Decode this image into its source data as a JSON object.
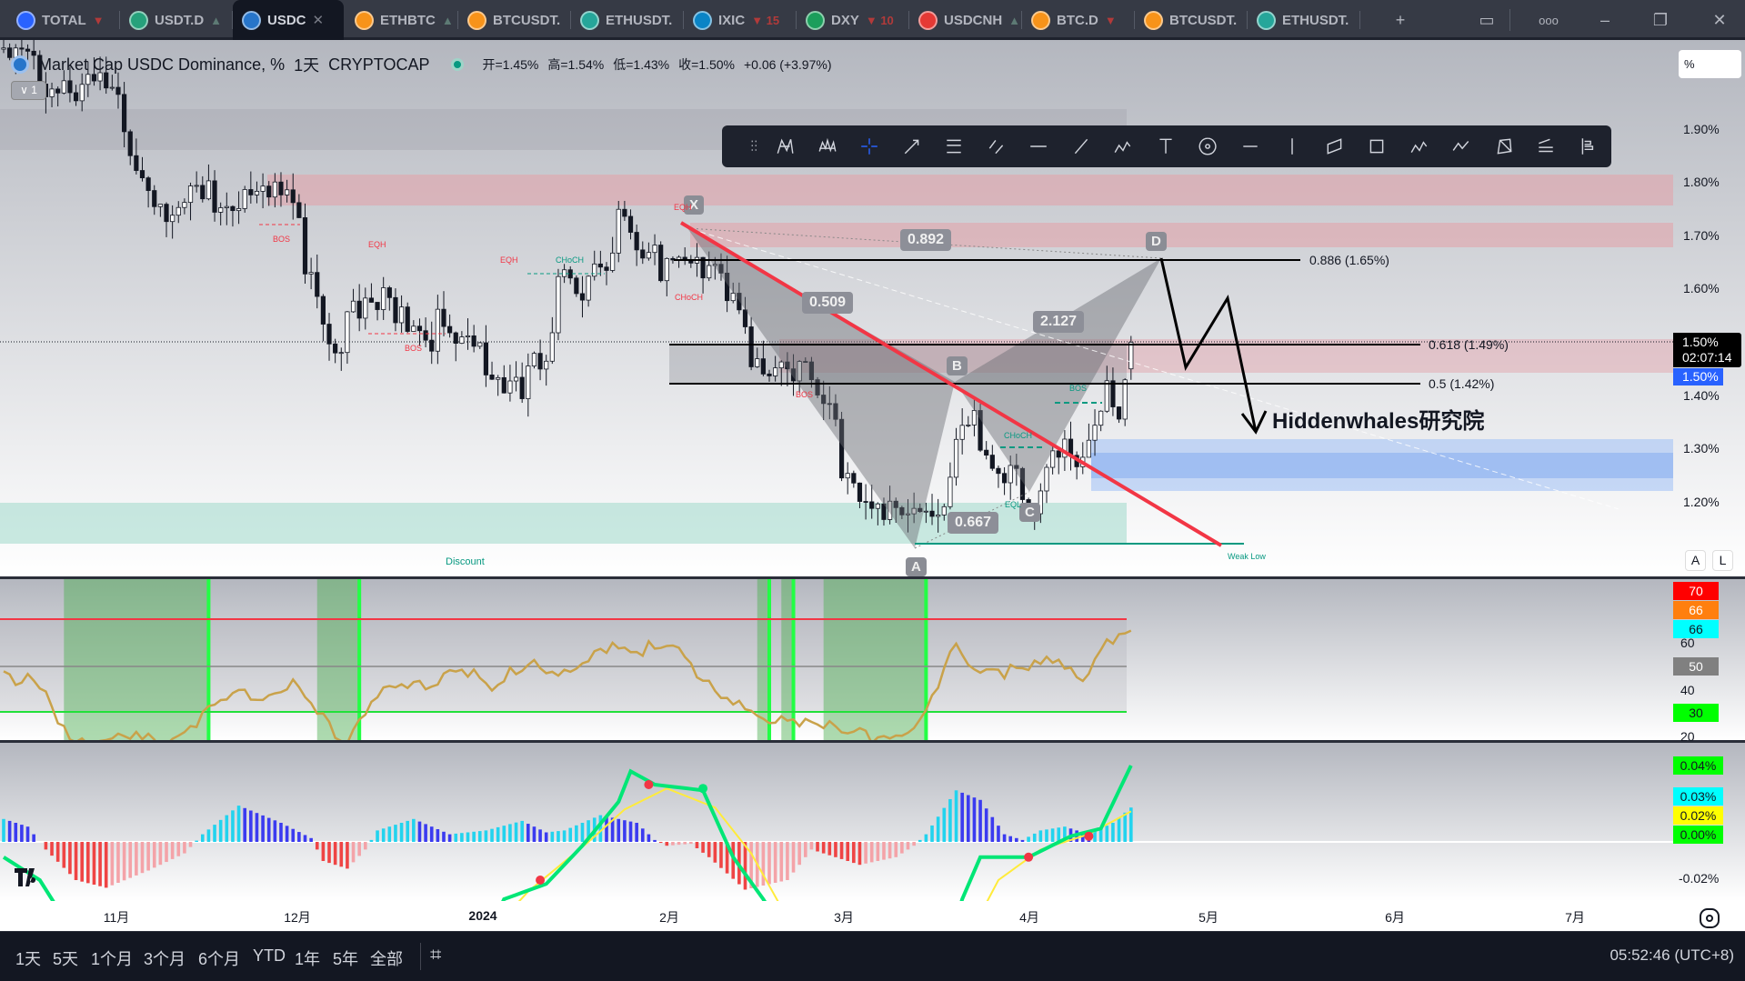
{
  "tabs": [
    {
      "label": "TOTAL",
      "change": "▼",
      "icon_color": "#2962ff"
    },
    {
      "label": "USDT.D",
      "change": "▲",
      "icon_color": "#26a17b"
    },
    {
      "label": "USDC",
      "change": "",
      "icon_color": "#2775ca",
      "active": true
    },
    {
      "label": "ETHBTC",
      "change": "▲",
      "icon_color": "#f7931a"
    },
    {
      "label": "BTCUSDT.",
      "change": "",
      "icon_color": "#f7931a"
    },
    {
      "label": "ETHUSDT.",
      "change": "",
      "icon_color": "#26a69a"
    },
    {
      "label": "IXIC",
      "change": "▼ 15",
      "icon_color": "#0a84c6"
    },
    {
      "label": "DXY",
      "change": "▼ 10",
      "icon_color": "#1b9e5b"
    },
    {
      "label": "USDCNH",
      "change": "▲",
      "icon_color": "#e53935"
    },
    {
      "label": "BTC.D",
      "change": "▼",
      "icon_color": "#f7931a"
    },
    {
      "label": "BTCUSDT.",
      "change": "",
      "icon_color": "#f7931a"
    },
    {
      "label": "ETHUSDT.",
      "change": "",
      "icon_color": "#26a69a"
    }
  ],
  "window": {
    "add_tab": "+",
    "layout": "▭",
    "more": "ooo",
    "minimize": "–",
    "restore": "❐",
    "close": "✕",
    "close_tab": "✕"
  },
  "legend": {
    "title": "Market Cap USDC Dominance, %",
    "interval": "1天",
    "exchange": "CRYPTOCAP",
    "open": "开=1.45%",
    "high": "高=1.54%",
    "low": "低=1.43%",
    "close": "收=1.50%",
    "change": "+0.06 (+3.97%)",
    "collapse": "∨ 1",
    "scale_mode": "%"
  },
  "toolbar_icons": [
    "drag-handle-icon",
    "xabcd-pattern-icon",
    "elliott-wave-icon",
    "crosshair-icon",
    "arrow-icon",
    "fib-retracement-icon",
    "parallel-channel-icon",
    "horizontal-ray-icon",
    "trend-line-icon",
    "abcd-numbered-icon",
    "text-icon",
    "circle-icon",
    "horizontal-line-icon",
    "vertical-line-icon",
    "parallelogram-icon",
    "rectangle-icon",
    "abc-pattern-icon",
    "path-icon",
    "triangle-pattern-icon",
    "fib-fan-icon",
    "long-position-icon"
  ],
  "price_axis": {
    "labels": [
      "1.90%",
      "1.80%",
      "1.70%",
      "1.60%",
      "1.40%",
      "1.30%",
      "1.20%"
    ],
    "last_price": "1.50%",
    "countdown": "02:07:14",
    "bid": "1.50%",
    "auto": "A",
    "log": "L"
  },
  "rsi_axis": {
    "labels": [
      "60",
      "40",
      "20"
    ],
    "tags": [
      {
        "text": "70",
        "color": "#ff0000"
      },
      {
        "text": "66",
        "color": "#ff7f0e"
      },
      {
        "text": "66",
        "color": "#00ffff"
      },
      {
        "text": "50",
        "color": "#808080"
      },
      {
        "text": "30",
        "color": "#00ff00"
      }
    ]
  },
  "macd_axis": {
    "labels": [
      "-0.02%"
    ],
    "tags": [
      {
        "text": "0.04%",
        "color": "#00ff00"
      },
      {
        "text": "0.03%",
        "color": "#00ffff"
      },
      {
        "text": "0.02%",
        "color": "#ffff00"
      },
      {
        "text": "0.00%",
        "color": "#00ff00"
      }
    ]
  },
  "time_axis": [
    "11月",
    "12月",
    "2024",
    "2月",
    "3月",
    "4月",
    "5月",
    "6月",
    "7月"
  ],
  "harmonic": {
    "points": [
      "X",
      "A",
      "B",
      "C",
      "D"
    ],
    "ratios": [
      "0.892",
      "0.509",
      "2.127",
      "0.667"
    ]
  },
  "fib_levels": [
    "0.886 (1.65%)",
    "0.618 (1.49%)",
    "0.5 (1.42%)"
  ],
  "smc_labels": [
    "BOS",
    "EQH",
    "BOS",
    "EQH",
    "CHoCH",
    "EQH",
    "CHoCH",
    "BOS",
    "BOS",
    "CHoCH",
    "EQL",
    "Discount",
    "Weak Low"
  ],
  "watermark_text": "Hiddenwhales研究院",
  "bottom": {
    "ranges": [
      "1天",
      "5天",
      "1个月",
      "3个月",
      "6个月",
      "YTD",
      "1年",
      "5年",
      "全部"
    ],
    "clock": "05:52:46 (UTC+8)"
  },
  "colors": {
    "up": "#ffffff",
    "down": "#131722",
    "rsi": "#c9a24a",
    "trend": "#f23645",
    "macd": "#00e676",
    "signal": "#ffeb3b"
  },
  "series": {
    "price_anchors": [
      [
        0,
        2.05
      ],
      [
        18,
        1.99
      ],
      [
        28,
        1.75
      ],
      [
        40,
        1.83
      ],
      [
        48,
        1.76
      ],
      [
        55,
        1.54
      ],
      [
        66,
        1.6
      ],
      [
        81,
        1.47
      ],
      [
        90,
        1.45
      ],
      [
        92,
        1.6
      ],
      [
        102,
        1.73
      ],
      [
        106,
        1.66
      ],
      [
        114,
        1.71
      ],
      [
        124,
        1.52
      ],
      [
        133,
        1.47
      ],
      [
        140,
        1.29
      ],
      [
        148,
        1.19
      ],
      [
        152,
        1.16
      ],
      [
        156,
        1.26
      ],
      [
        159,
        1.41
      ],
      [
        164,
        1.26
      ],
      [
        171,
        1.23
      ],
      [
        174,
        1.34
      ],
      [
        179,
        1.26
      ],
      [
        183,
        1.41
      ],
      [
        185,
        1.43
      ],
      [
        187,
        1.5
      ]
    ],
    "rsi_anchors": [
      [
        0,
        50
      ],
      [
        6,
        42
      ],
      [
        10,
        22
      ],
      [
        17,
        20
      ],
      [
        26,
        19
      ],
      [
        34,
        32
      ],
      [
        40,
        39
      ],
      [
        48,
        44
      ],
      [
        52,
        30
      ],
      [
        57,
        21
      ],
      [
        61,
        39
      ],
      [
        68,
        41
      ],
      [
        76,
        54
      ],
      [
        81,
        39
      ],
      [
        87,
        56
      ],
      [
        94,
        46
      ],
      [
        101,
        63
      ],
      [
        105,
        60
      ],
      [
        111,
        58
      ],
      [
        118,
        44
      ],
      [
        126,
        26
      ],
      [
        133,
        30
      ],
      [
        140,
        21
      ],
      [
        148,
        23
      ],
      [
        153,
        30
      ],
      [
        158,
        60
      ],
      [
        162,
        51
      ],
      [
        170,
        49
      ],
      [
        174,
        56
      ],
      [
        179,
        49
      ],
      [
        182,
        58
      ],
      [
        187,
        66
      ]
    ],
    "rsi_oversold_ranges": [
      [
        10,
        34
      ],
      [
        52,
        59
      ],
      [
        125,
        127
      ],
      [
        129,
        131
      ],
      [
        136,
        153
      ]
    ],
    "hist_anchors": [
      [
        0,
        0.012
      ],
      [
        4,
        0.008
      ],
      [
        7,
        -0.004
      ],
      [
        12,
        -0.02
      ],
      [
        17,
        -0.024
      ],
      [
        24,
        -0.015
      ],
      [
        30,
        -0.006
      ],
      [
        33,
        0.004
      ],
      [
        39,
        0.019
      ],
      [
        46,
        0.01
      ],
      [
        51,
        0.002
      ],
      [
        53,
        -0.01
      ],
      [
        57,
        -0.014
      ],
      [
        60,
        -0.004
      ],
      [
        62,
        0.006
      ],
      [
        68,
        0.012
      ],
      [
        74,
        0.004
      ],
      [
        80,
        0.006
      ],
      [
        86,
        0.011
      ],
      [
        90,
        0.005
      ],
      [
        93,
        0.006
      ],
      [
        99,
        0.014
      ],
      [
        105,
        0.01
      ],
      [
        108,
        0.001
      ],
      [
        110,
        -0.002
      ],
      [
        114,
        -0.001
      ],
      [
        117,
        -0.008
      ],
      [
        123,
        -0.025
      ],
      [
        130,
        -0.02
      ],
      [
        134,
        -0.004
      ],
      [
        136,
        -0.006
      ],
      [
        142,
        -0.012
      ],
      [
        148,
        -0.008
      ],
      [
        151,
        -0.002
      ],
      [
        153,
        0.004
      ],
      [
        158,
        0.027
      ],
      [
        162,
        0.022
      ],
      [
        166,
        0.004
      ],
      [
        169,
        0.001
      ],
      [
        172,
        0.006
      ],
      [
        176,
        0.008
      ],
      [
        180,
        0.004
      ],
      [
        184,
        0.01
      ],
      [
        187,
        0.018
      ]
    ],
    "macd_anchors": [
      [
        0,
        -0.008
      ],
      [
        6,
        -0.02
      ],
      [
        12,
        -0.05
      ],
      [
        80,
        -0.05
      ],
      [
        83,
        -0.03
      ],
      [
        90,
        -0.022
      ],
      [
        96,
        -0.002
      ],
      [
        102,
        0.021
      ],
      [
        104,
        0.037
      ],
      [
        108,
        0.03
      ],
      [
        116,
        0.027
      ],
      [
        121,
        -0.008
      ],
      [
        126,
        -0.03
      ],
      [
        130,
        -0.05
      ],
      [
        157,
        -0.05
      ],
      [
        159,
        -0.03
      ],
      [
        162,
        -0.008
      ],
      [
        170,
        -0.008
      ],
      [
        177,
        0.003
      ],
      [
        182,
        0.007
      ],
      [
        187,
        0.04
      ]
    ],
    "signal_anchors": [
      [
        80,
        -0.05
      ],
      [
        87,
        -0.026
      ],
      [
        97,
        0.0
      ],
      [
        103,
        0.017
      ],
      [
        110,
        0.028
      ],
      [
        118,
        0.018
      ],
      [
        124,
        -0.006
      ],
      [
        130,
        -0.04
      ],
      [
        133,
        -0.05
      ],
      [
        160,
        -0.05
      ],
      [
        165,
        -0.02
      ],
      [
        172,
        -0.004
      ],
      [
        180,
        0.004
      ],
      [
        187,
        0.016
      ]
    ],
    "cross_dots": [
      [
        89,
        -0.02,
        "#f23645"
      ],
      [
        107,
        0.03,
        "#f23645"
      ],
      [
        116,
        0.028,
        "#00e676"
      ],
      [
        170,
        -0.008,
        "#f23645"
      ],
      [
        180,
        0.003,
        "#f23645"
      ]
    ]
  }
}
